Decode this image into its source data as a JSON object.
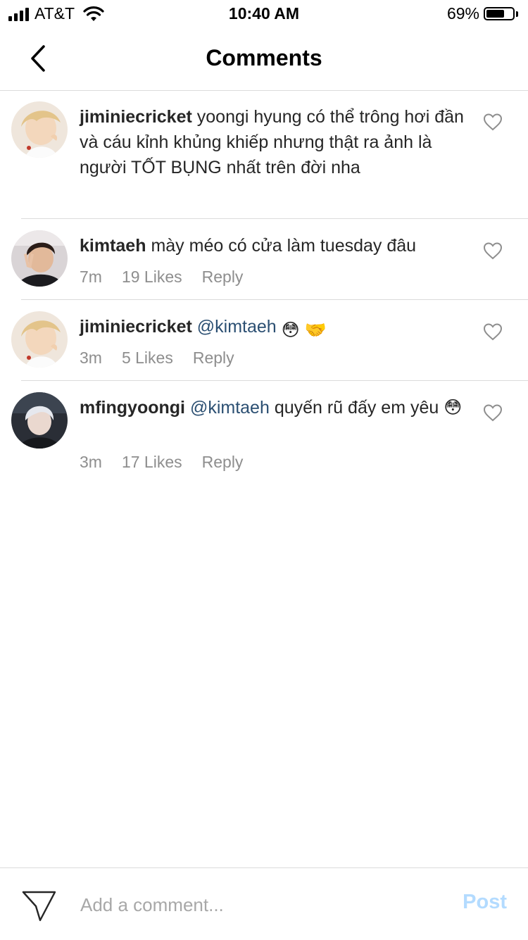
{
  "status_bar": {
    "carrier": "AT&T",
    "time": "10:40 AM",
    "battery_percent": "69%",
    "battery_level": 0.69,
    "icons": [
      "signal-icon",
      "wifi-icon",
      "battery-icon"
    ]
  },
  "header": {
    "title": "Comments",
    "back_icon": "chevron-left-icon"
  },
  "comments": [
    {
      "username": "jiminiecricket",
      "text": "yoongi hyung có thể trông hơi đần và cáu kỉnh khủng khiếp nhưng thật ra ảnh là người TỐT BỤNG nhất trên đời nha",
      "avatar": "avatar-blond-photo"
    },
    {
      "username": "kimtaeh",
      "text": "mày méo có cửa làm tuesday đâu",
      "time": "7m",
      "likes": "19 Likes",
      "reply": "Reply",
      "avatar": "avatar-dark-hair-photo"
    },
    {
      "username": "jiminiecricket",
      "mention": "@kimtaeh",
      "text": "😳 🤝",
      "time": "3m",
      "likes": "5 Likes",
      "reply": "Reply",
      "avatar": "avatar-blond-photo"
    },
    {
      "username": "mfingyoongi",
      "mention": "@kimtaeh",
      "text": "quyến rũ đấy em yêu 😳",
      "time": "3m",
      "likes": "17 Likes",
      "reply": "Reply",
      "avatar": "avatar-silver-hair-photo"
    }
  ],
  "composer": {
    "placeholder": "Add a comment...",
    "post_label": "Post",
    "send_icon": "paper-plane-icon"
  },
  "colors": {
    "mention": "#2b4f72",
    "meta": "#8e8e8e",
    "post_disabled": "#b3dbff",
    "divider": "#dbdbdb"
  }
}
